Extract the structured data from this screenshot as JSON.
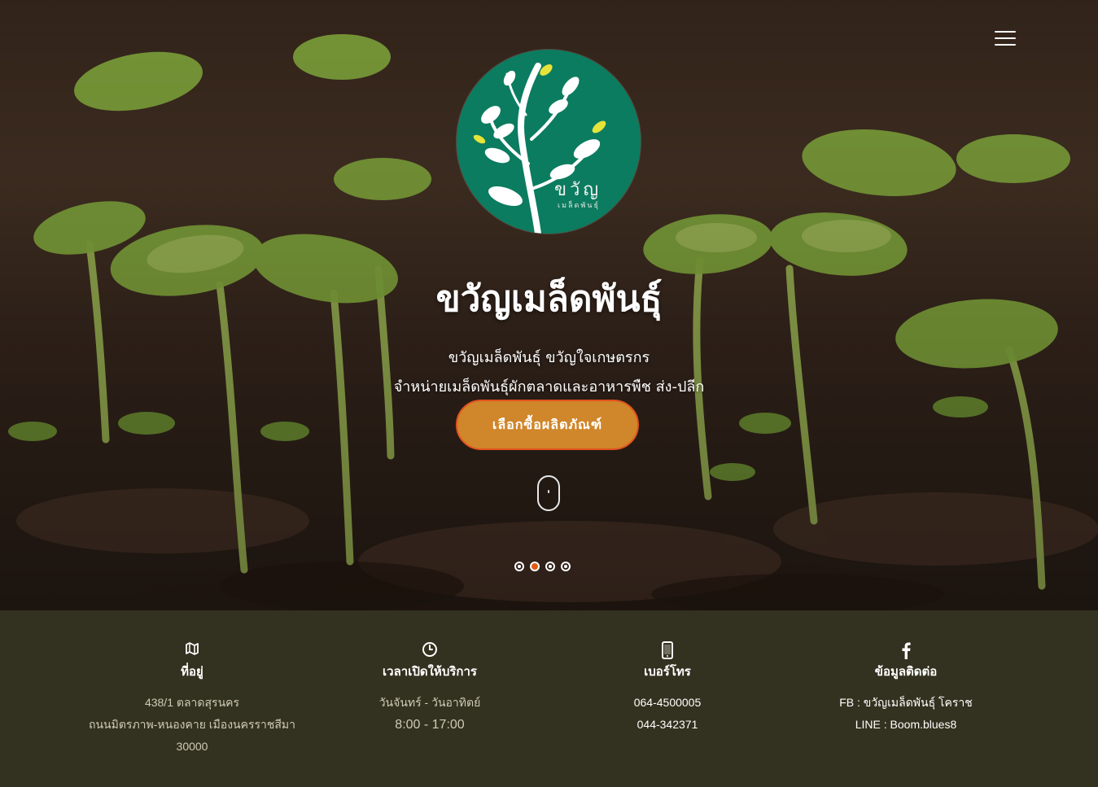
{
  "brand": {
    "logo_text": "ขวัญ",
    "logo_subtext": "เมล็ดพันธุ์"
  },
  "hero": {
    "title": "ขวัญเมล็ดพันธุ์",
    "subtitle_1": "ขวัญเมล็ดพันธุ์ ขวัญใจเกษตรกร",
    "subtitle_2": "จำหน่ายเมล็ดพันธุ์ผักตลาดและอาหารพืช ส่ง-ปลีก",
    "cta_label": "เลือกซื้อผลิตภัณฑ์",
    "slides_total": 4,
    "active_slide": 2
  },
  "colors": {
    "accent": "#d0862a",
    "accent_border": "#e2531e",
    "footer_bg": "#33311f",
    "logo_bg": "#0b7c5f"
  },
  "footer": {
    "address": {
      "icon": "map-icon",
      "heading": "ที่อยู่",
      "lines": [
        "438/1 ตลาดสุรนคร",
        "ถนนมิตรภาพ-หนองคาย เมืองนครราชสีมา",
        "30000"
      ]
    },
    "hours": {
      "icon": "clock-icon",
      "heading": "เวลาเปิดให้บริการ",
      "lines": [
        "วันจันทร์ - วันอาทิตย์",
        "8:00 - 17:00"
      ]
    },
    "phone": {
      "icon": "mobile-icon",
      "heading": "เบอร์โทร",
      "lines": [
        "064-4500005",
        "044-342371"
      ]
    },
    "contact": {
      "icon": "facebook-icon",
      "heading": "ข้อมูลติดต่อ",
      "lines": [
        "FB : ขวัญเมล็ดพันธุ์ โคราช",
        "LINE : Boom.blues8"
      ]
    }
  }
}
